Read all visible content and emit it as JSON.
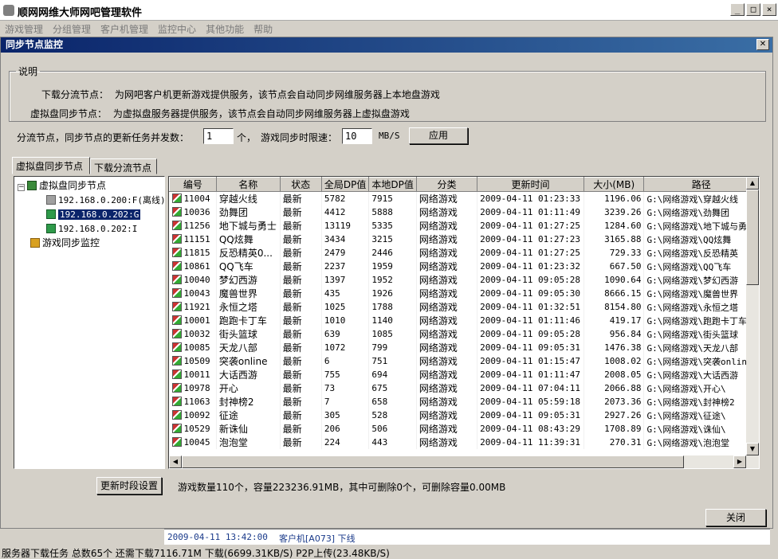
{
  "app": {
    "title": "顺网网维大师网吧管理软件"
  },
  "menu": [
    "游戏管理",
    "分组管理",
    "客户机管理",
    "监控中心",
    "其他功能",
    "帮助"
  ],
  "dialog": {
    "title": "同步节点监控",
    "desc": {
      "legend": "说明",
      "row1_label": "下载分流节点：",
      "row1_text": "为网吧客户机更新游戏提供服务，该节点会自动同步网维服务器上本地盘游戏",
      "row2_label": "虚拟盘同步节点：",
      "row2_text": "为虚拟盘服务器提供服务，该节点会自动同步网维服务器上虚拟盘游戏"
    },
    "config": {
      "concurrency_label": "分流节点，同步节点的更新任务并发数：",
      "concurrency_value": "1",
      "unit_count": "个，",
      "speed_label": "游戏同步时限速：",
      "speed_value": "10",
      "speed_unit": "MB/S",
      "apply_label": "应用"
    },
    "tabs": [
      "虚拟盘同步节点",
      "下载分流节点"
    ],
    "tree": {
      "root": "虚拟盘同步节点",
      "expander": "−",
      "children": [
        "192.168.0.200:F(离线)",
        "192.168.0.202:G",
        "192.168.0.202:I"
      ],
      "monitor": "游戏同步监控"
    },
    "table": {
      "headers": [
        "编号",
        "名称",
        "状态",
        "全局DP值",
        "本地DP值",
        "分类",
        "更新时间",
        "大小(MB)",
        "路径"
      ],
      "rows": [
        [
          "11004",
          "穿越火线",
          "最新",
          "5782",
          "7915",
          "网络游戏",
          "2009-04-11 01:23:33",
          "1196.06",
          "G:\\网络游戏\\穿越火线"
        ],
        [
          "10036",
          "劲舞团",
          "最新",
          "4412",
          "5888",
          "网络游戏",
          "2009-04-11 01:11:49",
          "3239.26",
          "G:\\网络游戏\\劲舞团"
        ],
        [
          "11256",
          "地下城与勇士",
          "最新",
          "13119",
          "5335",
          "网络游戏",
          "2009-04-11 01:27:25",
          "1284.60",
          "G:\\网络游戏\\地下城与勇士"
        ],
        [
          "11151",
          "QQ炫舞",
          "最新",
          "3434",
          "3215",
          "网络游戏",
          "2009-04-11 01:27:23",
          "3165.88",
          "G:\\网络游戏\\QQ炫舞"
        ],
        [
          "11815",
          "反恐精英0...",
          "最新",
          "2479",
          "2446",
          "网络游戏",
          "2009-04-11 01:27:25",
          "729.33",
          "G:\\网络游戏\\反恐精英"
        ],
        [
          "10861",
          "QQ飞车",
          "最新",
          "2237",
          "1959",
          "网络游戏",
          "2009-04-11 01:23:32",
          "667.50",
          "G:\\网络游戏\\QQ飞车"
        ],
        [
          "10040",
          "梦幻西游",
          "最新",
          "1397",
          "1952",
          "网络游戏",
          "2009-04-11 09:05:28",
          "1090.64",
          "G:\\网络游戏\\梦幻西游"
        ],
        [
          "10043",
          "魔兽世界",
          "最新",
          "435",
          "1926",
          "网络游戏",
          "2009-04-11 09:05:30",
          "8666.15",
          "G:\\网络游戏\\魔兽世界"
        ],
        [
          "11921",
          "永恒之塔",
          "最新",
          "1025",
          "1788",
          "网络游戏",
          "2009-04-11 01:32:51",
          "8154.80",
          "G:\\网络游戏\\永恒之塔"
        ],
        [
          "10001",
          "跑跑卡丁车",
          "最新",
          "1010",
          "1140",
          "网络游戏",
          "2009-04-11 01:11:46",
          "419.17",
          "G:\\网络游戏\\跑跑卡丁车"
        ],
        [
          "10032",
          "街头篮球",
          "最新",
          "639",
          "1085",
          "网络游戏",
          "2009-04-11 09:05:28",
          "956.84",
          "G:\\网络游戏\\街头篮球"
        ],
        [
          "10085",
          "天龙八部",
          "最新",
          "1072",
          "799",
          "网络游戏",
          "2009-04-11 09:05:31",
          "1476.38",
          "G:\\网络游戏\\天龙八部"
        ],
        [
          "10509",
          "突袭online",
          "最新",
          "6",
          "751",
          "网络游戏",
          "2009-04-11 01:15:47",
          "1008.02",
          "G:\\网络游戏\\突袭online"
        ],
        [
          "10011",
          "大话西游",
          "最新",
          "755",
          "694",
          "网络游戏",
          "2009-04-11 01:11:47",
          "2008.05",
          "G:\\网络游戏\\大话西游"
        ],
        [
          "10978",
          "开心",
          "最新",
          "73",
          "675",
          "网络游戏",
          "2009-04-11 07:04:11",
          "2066.88",
          "G:\\网络游戏\\开心\\"
        ],
        [
          "11063",
          "封神榜2",
          "最新",
          "7",
          "658",
          "网络游戏",
          "2009-04-11 05:59:18",
          "2073.36",
          "G:\\网络游戏\\封神榜2"
        ],
        [
          "10092",
          "征途",
          "最新",
          "305",
          "528",
          "网络游戏",
          "2009-04-11 09:05:31",
          "2927.26",
          "G:\\网络游戏\\征途\\"
        ],
        [
          "10529",
          "新诛仙",
          "最新",
          "206",
          "506",
          "网络游戏",
          "2009-04-11 08:43:29",
          "1708.89",
          "G:\\网络游戏\\诛仙\\"
        ],
        [
          "10045",
          "泡泡堂",
          "最新",
          "224",
          "443",
          "网络游戏",
          "2009-04-11 11:39:31",
          "270.31",
          "G:\\网络游戏\\泡泡堂"
        ]
      ]
    },
    "update_btn": "更新时段设置",
    "summary": "游戏数量110个，容量223236.91MB，其中可删除0个，可删除容量0.00MB",
    "close_btn": "关闭"
  },
  "log": {
    "time": "2009-04-11 13:42:00",
    "msg": "客户机[A073] 下线"
  },
  "status": {
    "download_tasks": "服务器下载任务  总数65个  还需下载7116.71M  下载(6699.31KB/S)  P2P上传(23.48KB/S)"
  }
}
